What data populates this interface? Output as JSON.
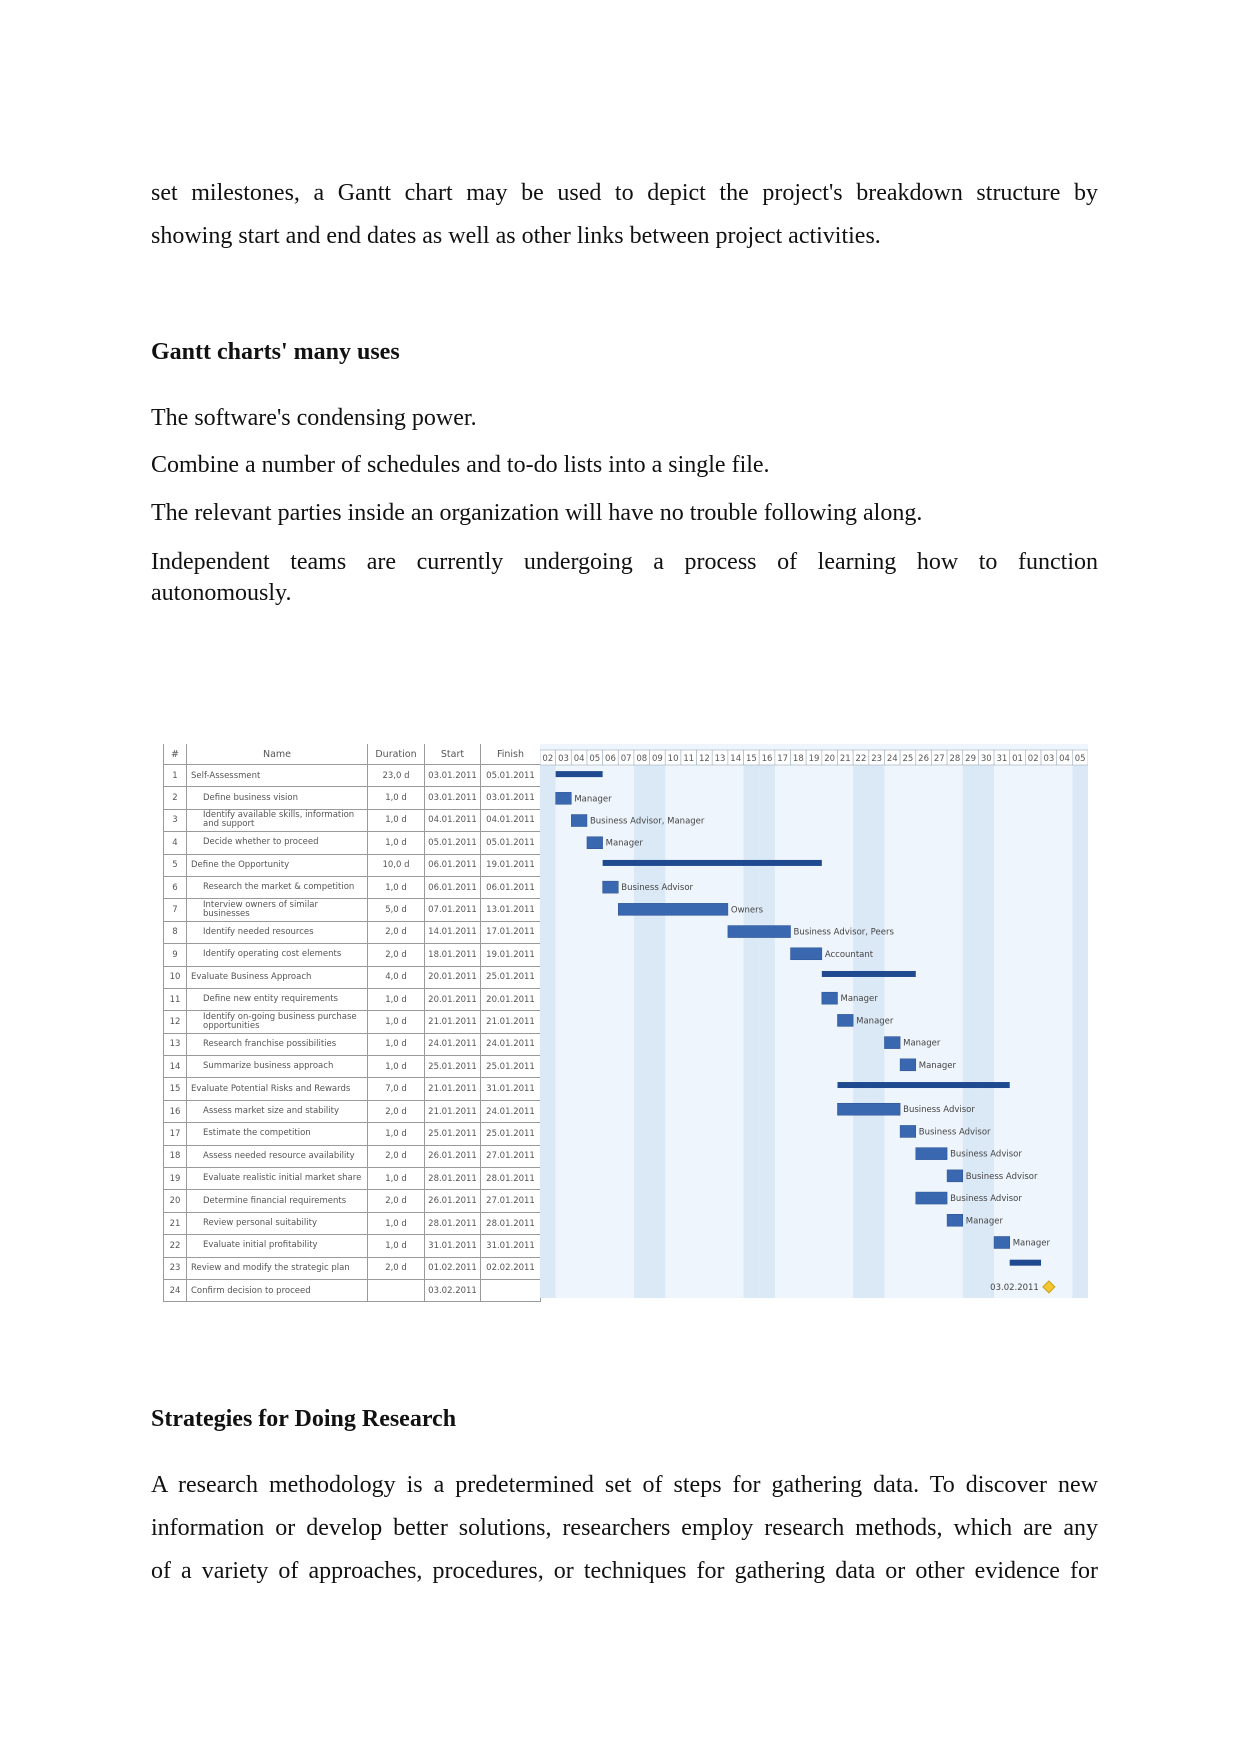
{
  "intro": {
    "line1": "set milestones, a Gantt chart may be used to depict the project's breakdown structure by",
    "line2": "showing start and end dates as well as other links between project activities."
  },
  "section1": {
    "heading": "Gantt charts' many uses",
    "items": [
      "The software's condensing power.",
      "Combine a number of schedules and to-do lists into a single file.",
      "The relevant parties inside an organization will have no trouble following along.",
      "Independent teams are currently undergoing a process of learning how to function",
      "autonomously."
    ]
  },
  "gantt": {
    "headers": {
      "num": "#",
      "name": "Name",
      "duration": "Duration",
      "start": "Start",
      "finish": "Finish"
    },
    "days": [
      "02",
      "03",
      "04",
      "05",
      "06",
      "07",
      "08",
      "09",
      "10",
      "11",
      "12",
      "13",
      "14",
      "15",
      "16",
      "17",
      "18",
      "19",
      "20",
      "21",
      "22",
      "23",
      "24",
      "25",
      "26",
      "27",
      "28",
      "29",
      "30",
      "31",
      "01",
      "02",
      "03",
      "04",
      "05"
    ],
    "colors": {
      "bar": "#3a68b0",
      "summary": "#1f4a8f",
      "milestone": "#f2c62e",
      "weekend": "#dbe9f6",
      "background": "#eef5fc"
    },
    "tasks": [
      {
        "num": "1",
        "name": "Self-Assessment",
        "duration": "23,0 d",
        "start": "03.01.2011",
        "finish": "05.01.2011",
        "summary": true,
        "resource": ""
      },
      {
        "num": "2",
        "name": "Define business vision",
        "duration": "1,0 d",
        "start": "03.01.2011",
        "finish": "03.01.2011",
        "resource": "Manager"
      },
      {
        "num": "3",
        "name": "Identify available skills, information and support",
        "duration": "1,0 d",
        "start": "04.01.2011",
        "finish": "04.01.2011",
        "resource": "Business Advisor, Manager"
      },
      {
        "num": "4",
        "name": "Decide whether to proceed",
        "duration": "1,0 d",
        "start": "05.01.2011",
        "finish": "05.01.2011",
        "resource": "Manager"
      },
      {
        "num": "5",
        "name": "Define the Opportunity",
        "duration": "10,0 d",
        "start": "06.01.2011",
        "finish": "19.01.2011",
        "summary": true,
        "resource": ""
      },
      {
        "num": "6",
        "name": "Research the market & competition",
        "duration": "1,0 d",
        "start": "06.01.2011",
        "finish": "06.01.2011",
        "resource": "Business Advisor"
      },
      {
        "num": "7",
        "name": "Interview owners of similar businesses",
        "duration": "5,0 d",
        "start": "07.01.2011",
        "finish": "13.01.2011",
        "resource": "Owners"
      },
      {
        "num": "8",
        "name": "Identify needed resources",
        "duration": "2,0 d",
        "start": "14.01.2011",
        "finish": "17.01.2011",
        "resource": "Business Advisor, Peers"
      },
      {
        "num": "9",
        "name": "Identify operating cost elements",
        "duration": "2,0 d",
        "start": "18.01.2011",
        "finish": "19.01.2011",
        "resource": "Accountant"
      },
      {
        "num": "10",
        "name": "Evaluate Business Approach",
        "duration": "4,0 d",
        "start": "20.01.2011",
        "finish": "25.01.2011",
        "summary": true,
        "resource": ""
      },
      {
        "num": "11",
        "name": "Define new entity requirements",
        "duration": "1,0 d",
        "start": "20.01.2011",
        "finish": "20.01.2011",
        "resource": "Manager"
      },
      {
        "num": "12",
        "name": "Identify on-going business purchase opportunities",
        "duration": "1,0 d",
        "start": "21.01.2011",
        "finish": "21.01.2011",
        "resource": "Manager"
      },
      {
        "num": "13",
        "name": "Research franchise possibilities",
        "duration": "1,0 d",
        "start": "24.01.2011",
        "finish": "24.01.2011",
        "resource": "Manager"
      },
      {
        "num": "14",
        "name": "Summarize business approach",
        "duration": "1,0 d",
        "start": "25.01.2011",
        "finish": "25.01.2011",
        "resource": "Manager"
      },
      {
        "num": "15",
        "name": "Evaluate Potential Risks and Rewards",
        "duration": "7,0 d",
        "start": "21.01.2011",
        "finish": "31.01.2011",
        "summary": true,
        "resource": ""
      },
      {
        "num": "16",
        "name": "Assess market size and stability",
        "duration": "2,0 d",
        "start": "21.01.2011",
        "finish": "24.01.2011",
        "resource": "Business Advisor"
      },
      {
        "num": "17",
        "name": "Estimate the competition",
        "duration": "1,0 d",
        "start": "25.01.2011",
        "finish": "25.01.2011",
        "resource": "Business Advisor"
      },
      {
        "num": "18",
        "name": "Assess needed resource availability",
        "duration": "2,0 d",
        "start": "26.01.2011",
        "finish": "27.01.2011",
        "resource": "Business Advisor"
      },
      {
        "num": "19",
        "name": "Evaluate realistic initial market share",
        "duration": "1,0 d",
        "start": "28.01.2011",
        "finish": "28.01.2011",
        "resource": "Business Advisor"
      },
      {
        "num": "20",
        "name": "Determine financial requirements",
        "duration": "2,0 d",
        "start": "26.01.2011",
        "finish": "27.01.2011",
        "resource": "Business Advisor"
      },
      {
        "num": "21",
        "name": "Review personal suitability",
        "duration": "1,0 d",
        "start": "28.01.2011",
        "finish": "28.01.2011",
        "resource": "Manager"
      },
      {
        "num": "22",
        "name": "Evaluate initial profitability",
        "duration": "1,0 d",
        "start": "31.01.2011",
        "finish": "31.01.2011",
        "resource": "Manager"
      },
      {
        "num": "23",
        "name": "Review and modify the strategic plan",
        "duration": "2,0 d",
        "start": "01.02.2011",
        "finish": "02.02.2011",
        "summary": true,
        "resource": ""
      },
      {
        "num": "24",
        "name": "Confirm decision to proceed",
        "duration": "",
        "start": "03.02.2011",
        "finish": "",
        "milestone": true,
        "resource": "03.02.2011"
      }
    ]
  },
  "section2": {
    "heading": "Strategies for Doing Research",
    "lines": [
      "A research methodology is a predetermined set of steps for gathering data. To discover new",
      "information or develop better solutions, researchers employ research methods, which are any",
      "of a variety of approaches, procedures, or techniques for gathering data or other evidence for"
    ]
  }
}
